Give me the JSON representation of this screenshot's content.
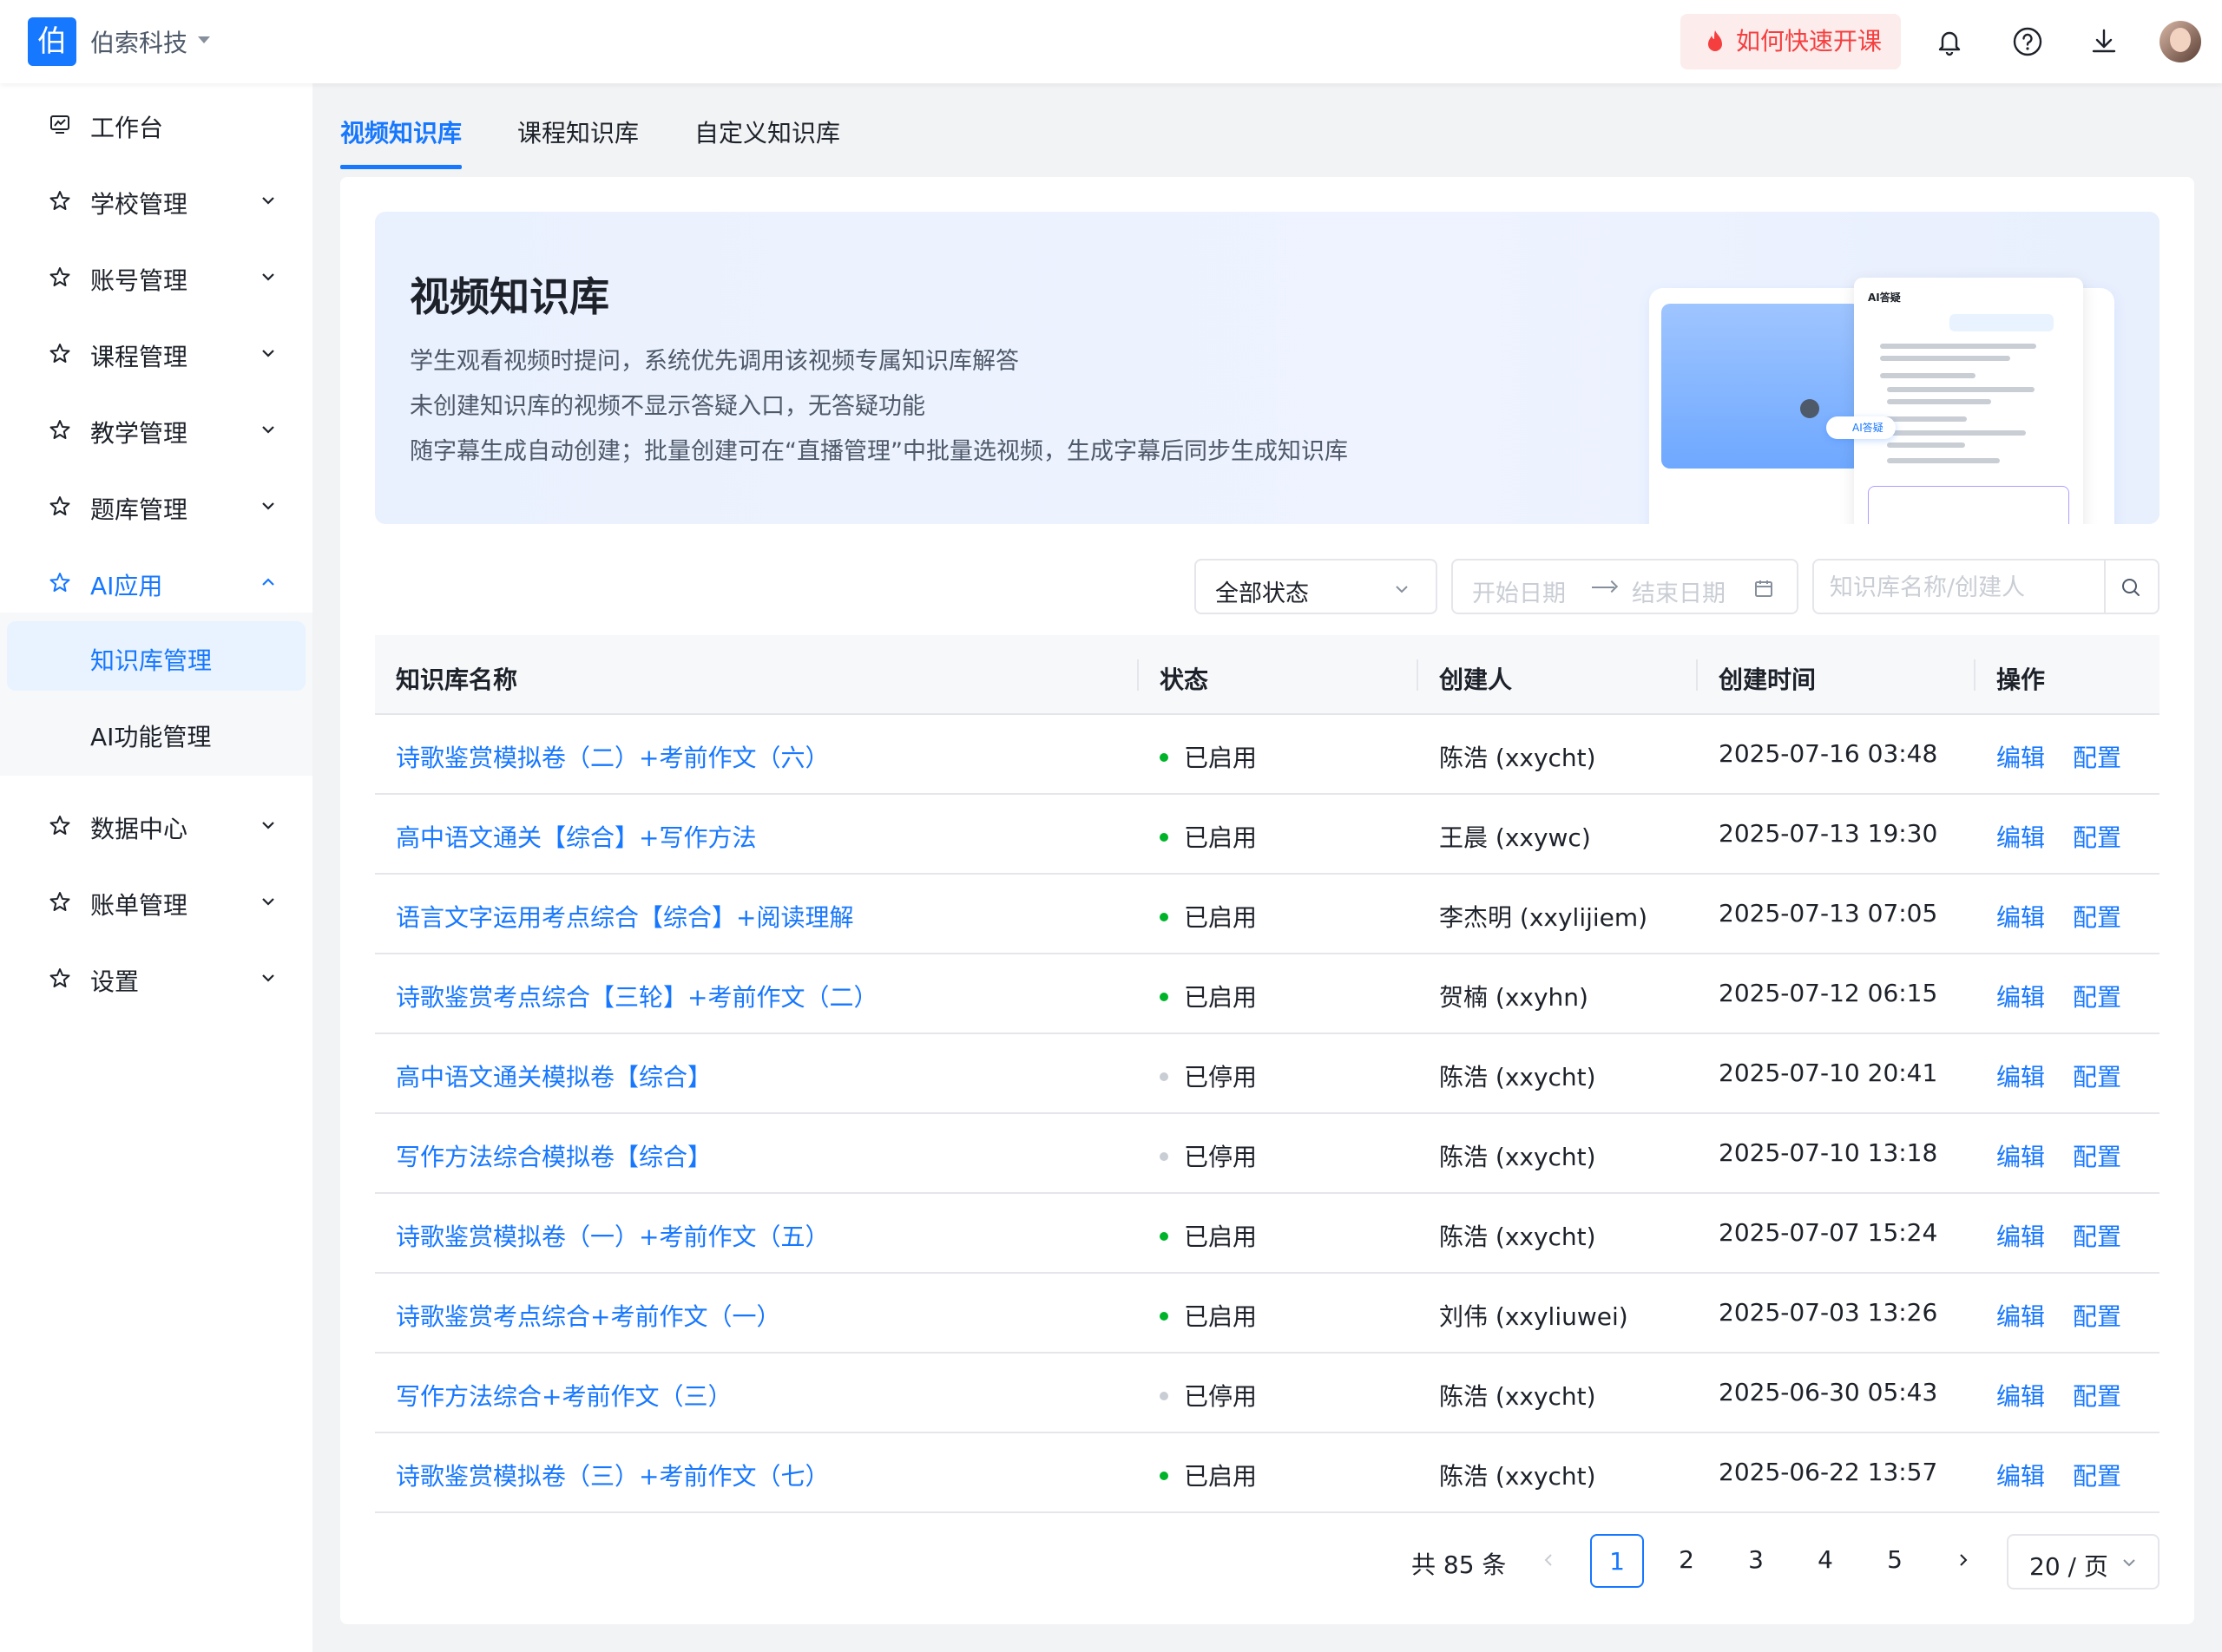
{
  "topbar": {
    "logo_char": "伯",
    "brand": "伯索科技",
    "quick_start": "如何快速开课",
    "icons": [
      "bell-icon",
      "help-icon",
      "download-icon",
      "avatar"
    ]
  },
  "sidebar": {
    "items": [
      {
        "label": "工作台",
        "icon": "dashboard-icon",
        "expandable": false
      },
      {
        "label": "学校管理",
        "icon": "star-icon",
        "expandable": true
      },
      {
        "label": "账号管理",
        "icon": "star-icon",
        "expandable": true
      },
      {
        "label": "课程管理",
        "icon": "star-icon",
        "expandable": true
      },
      {
        "label": "教学管理",
        "icon": "star-icon",
        "expandable": true
      },
      {
        "label": "题库管理",
        "icon": "star-icon",
        "expandable": true
      },
      {
        "label": "AI应用",
        "icon": "star-icon",
        "expandable": true,
        "expanded": true,
        "active": true
      },
      {
        "label": "数据中心",
        "icon": "star-icon",
        "expandable": true
      },
      {
        "label": "账单管理",
        "icon": "star-icon",
        "expandable": true
      },
      {
        "label": "设置",
        "icon": "star-icon",
        "expandable": true
      }
    ],
    "sub_items": [
      {
        "label": "知识库管理",
        "active": true
      },
      {
        "label": "AI功能管理",
        "active": false
      }
    ]
  },
  "tabs": [
    {
      "label": "视频知识库",
      "active": true
    },
    {
      "label": "课程知识库",
      "active": false
    },
    {
      "label": "自定义知识库",
      "active": false
    }
  ],
  "banner": {
    "title": "视频知识库",
    "lines": [
      "学生观看视频时提问，系统优先调用该视频专属知识库解答",
      "未创建知识库的视频不显示答疑入口，无答疑功能",
      "随字幕生成自动创建；批量创建可在“直播管理”中批量选视频，生成字幕后同步生成知识库"
    ],
    "mock_chat_title": "AI答疑",
    "mock_pill": "AI答疑"
  },
  "filters": {
    "status_value": "全部状态",
    "date_start_placeholder": "开始日期",
    "date_end_placeholder": "结束日期",
    "search_placeholder": "知识库名称/创建人"
  },
  "table": {
    "columns": [
      "知识库名称",
      "状态",
      "创建人",
      "创建时间",
      "操作"
    ],
    "actions": {
      "edit": "编辑",
      "config": "配置"
    },
    "rows": [
      {
        "name": "诗歌鉴赏模拟卷（二）+考前作文（六）",
        "status": "已启用",
        "enabled": true,
        "creator": "陈浩 (xxycht)",
        "time": "2025-07-16 03:48"
      },
      {
        "name": "高中语文通关【综合】+写作方法",
        "status": "已启用",
        "enabled": true,
        "creator": "王晨 (xxywc)",
        "time": "2025-07-13 19:30"
      },
      {
        "name": "语言文字运用考点综合【综合】+阅读理解",
        "status": "已启用",
        "enabled": true,
        "creator": "李杰明 (xxylijiem)",
        "time": "2025-07-13 07:05"
      },
      {
        "name": "诗歌鉴赏考点综合【三轮】+考前作文（二）",
        "status": "已启用",
        "enabled": true,
        "creator": "贺楠 (xxyhn)",
        "time": "2025-07-12 06:15"
      },
      {
        "name": "高中语文通关模拟卷【综合】",
        "status": "已停用",
        "enabled": false,
        "creator": "陈浩 (xxycht)",
        "time": "2025-07-10 20:41"
      },
      {
        "name": "写作方法综合模拟卷【综合】",
        "status": "已停用",
        "enabled": false,
        "creator": "陈浩 (xxycht)",
        "time": "2025-07-10 13:18"
      },
      {
        "name": "诗歌鉴赏模拟卷（一）+考前作文（五）",
        "status": "已启用",
        "enabled": true,
        "creator": "陈浩 (xxycht)",
        "time": "2025-07-07 15:24"
      },
      {
        "name": "诗歌鉴赏考点综合+考前作文（一）",
        "status": "已启用",
        "enabled": true,
        "creator": "刘伟 (xxyliuwei)",
        "time": "2025-07-03 13:26"
      },
      {
        "name": "写作方法综合+考前作文（三）",
        "status": "已停用",
        "enabled": false,
        "creator": "陈浩 (xxycht)",
        "time": "2025-06-30 05:43"
      },
      {
        "name": "诗歌鉴赏模拟卷（三）+考前作文（七）",
        "status": "已启用",
        "enabled": true,
        "creator": "陈浩 (xxycht)",
        "time": "2025-06-22 13:57"
      }
    ]
  },
  "pagination": {
    "total": "共 85 条",
    "pages": [
      "1",
      "2",
      "3",
      "4",
      "5"
    ],
    "current": "1",
    "page_size": "20 / 页"
  },
  "colors": {
    "primary": "#1677ff",
    "enabled": "#00b42a",
    "disabled": "#c9cdd4",
    "quick_start": "#f53f3f"
  }
}
